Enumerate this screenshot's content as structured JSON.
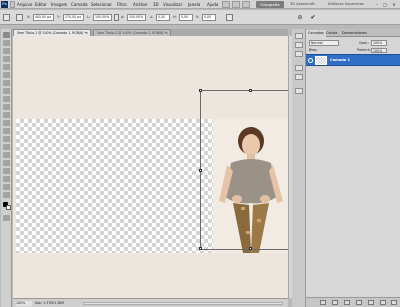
{
  "app": {
    "logo_text": "Ps"
  },
  "menu": {
    "items": [
      "Arquivo",
      "Editar",
      "Imagem",
      "Camada",
      "Selecionar",
      "Filtro",
      "Análise",
      "3D",
      "Visualizar",
      "Janela",
      "Ajuda"
    ]
  },
  "workspace": {
    "active": "Fotografia",
    "other": [
      "3D Axonomét.",
      "Ediitores Superiores"
    ],
    "window_controls": [
      "–",
      "□",
      "✕"
    ]
  },
  "options": {
    "field_x": "405,00 px",
    "field_y": "270,00 px",
    "field_w": "100,00%",
    "field_h": "100,00%",
    "field_angle": "0,00",
    "field_h_skew": "0,00",
    "field_v_skew": "0,00",
    "cancel_label": "⊘",
    "commit_label": "✔"
  },
  "document_tabs": [
    {
      "label": "Sem Título-1 @ 100% (Camada 1, RGB/8) *",
      "close": "×"
    },
    {
      "label": "Sem Título-2 @ 100% (Camada 2, RGB/8) *",
      "close": "×"
    }
  ],
  "status": {
    "zoom": "100%",
    "info": "Doc: 1,37M/1,38M"
  },
  "layers_panel": {
    "tabs": [
      "Camadas",
      "Canais",
      "Demarcadores"
    ],
    "blend_mode": "Normal",
    "opacity_label": "Opac.:",
    "opacity_value": "100%",
    "lock_label": "Bloq.:",
    "fill_label": "Preench.:",
    "fill_value": "100%",
    "layers": [
      {
        "name": "Camada 1",
        "visible": true,
        "selected": true
      }
    ]
  },
  "colors": {
    "accent": "#2f6ec6",
    "canvas_bg": "#ede6de"
  }
}
